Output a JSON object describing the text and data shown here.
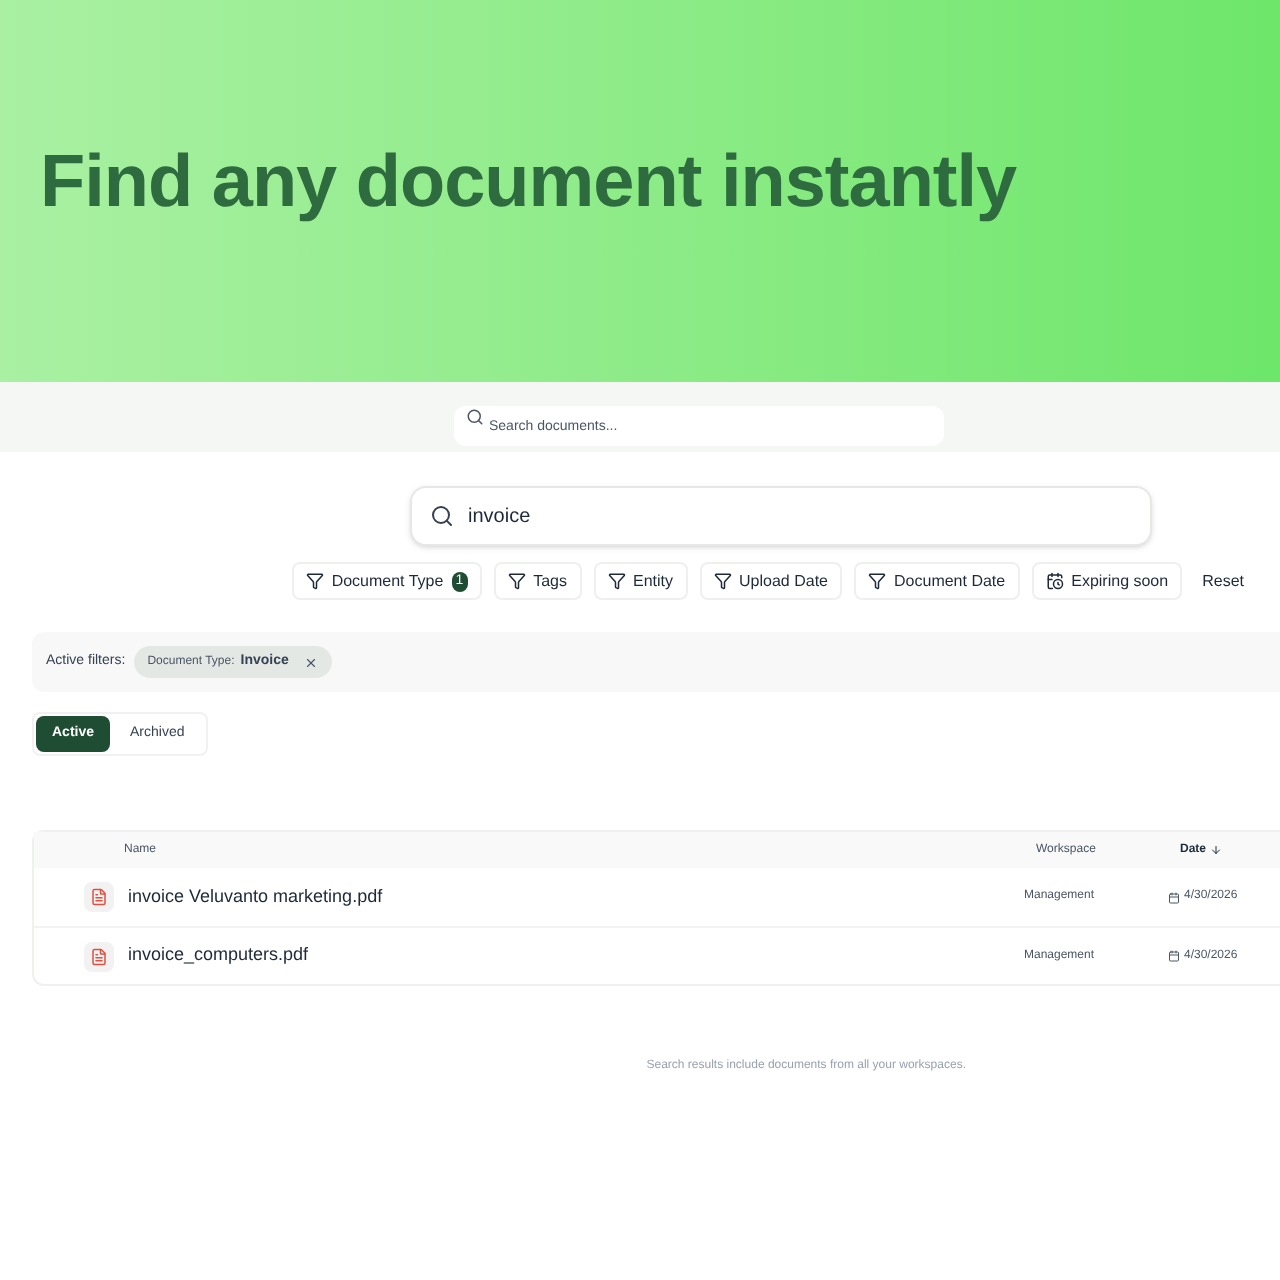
{
  "hero": {
    "headline": "Find any document instantly"
  },
  "top_search": {
    "placeholder": "Search documents..."
  },
  "search": {
    "value": "invoice"
  },
  "filters": [
    {
      "label": "Document Type",
      "kind": "filter",
      "count": "1"
    },
    {
      "label": "Tags",
      "kind": "filter"
    },
    {
      "label": "Entity",
      "kind": "filter"
    },
    {
      "label": "Upload Date",
      "kind": "filter"
    },
    {
      "label": "Document Date",
      "kind": "filter"
    },
    {
      "label": "Expiring soon",
      "kind": "expiring"
    },
    {
      "label": "Reset",
      "kind": "reset"
    }
  ],
  "active_filters": {
    "label": "Active filters:",
    "chips": [
      {
        "name": "Document Type:",
        "value": "Invoice"
      }
    ]
  },
  "tabs": [
    {
      "label": "Active",
      "selected": true
    },
    {
      "label": "Archived",
      "selected": false
    }
  ],
  "table": {
    "columns": [
      {
        "label": "Name"
      },
      {
        "label": "Workspace"
      },
      {
        "label": "Date",
        "sorted": true
      }
    ],
    "rows": [
      {
        "name": "invoice Veluvanto marketing.pdf",
        "workspace": "Management",
        "date": "4/30/2026"
      },
      {
        "name": "invoice_computers.pdf",
        "workspace": "Management",
        "date": "4/30/2026"
      }
    ]
  },
  "note": "Search results include documents from all your workspaces."
}
